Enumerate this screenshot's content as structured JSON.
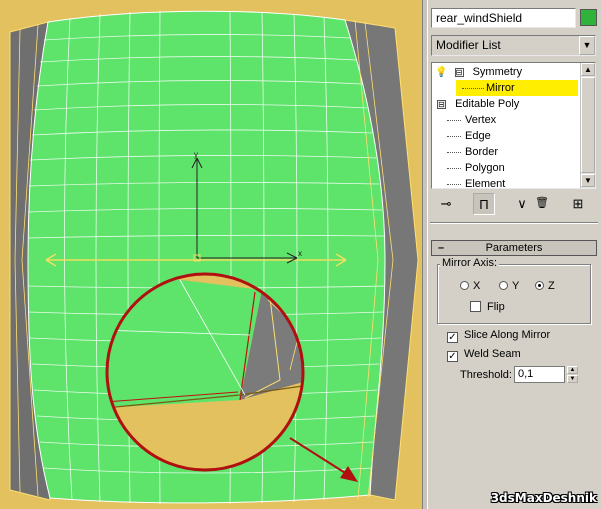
{
  "viewport": {
    "colors": {
      "background": "#e2c15e",
      "mesh": "#5ee36b",
      "mesh_dark": "#808080",
      "wire": "#ffffff",
      "axis": "#222222",
      "gizmo": "#f0e060",
      "callout": "#b01010"
    },
    "gizmo_labels": {
      "y": "y",
      "x": "x"
    }
  },
  "panel": {
    "object_name": "rear_windShield",
    "object_color": "#2fb33b",
    "modifier_list": {
      "label": "Modifier List"
    },
    "stack": [
      {
        "label": "Symmetry",
        "kind": "modifier",
        "expanded": "⊟",
        "icon": "lightbulb-icon"
      },
      {
        "label": "Mirror",
        "kind": "sub",
        "selected": true
      },
      {
        "label": "Editable Poly",
        "kind": "base",
        "expanded": "⊟"
      },
      {
        "label": "Vertex",
        "kind": "sub"
      },
      {
        "label": "Edge",
        "kind": "sub"
      },
      {
        "label": "Border",
        "kind": "sub"
      },
      {
        "label": "Polygon",
        "kind": "sub"
      },
      {
        "label": "Element",
        "kind": "sub"
      }
    ],
    "toolbar": [
      {
        "name": "pin-stack-icon",
        "glyph": "⊸"
      },
      {
        "name": "show-end-result-icon",
        "glyph": "Π"
      },
      {
        "name": "make-unique-icon",
        "glyph": "∨"
      },
      {
        "name": "remove-modifier-icon",
        "glyph": "🗑"
      },
      {
        "name": "configure-sets-icon",
        "glyph": "⊞"
      }
    ],
    "parameters": {
      "title": "Parameters",
      "collapse": "–",
      "mirror_axis": {
        "label": "Mirror Axis:",
        "options": [
          "X",
          "Y",
          "Z"
        ],
        "selected": "Z"
      },
      "flip": {
        "label": "Flip",
        "checked": false
      },
      "slice_along_mirror": {
        "label": "Slice Along Mirror",
        "checked": true,
        "mark": "✓"
      },
      "weld_seam": {
        "label": "Weld Seam",
        "checked": true,
        "mark": "✓"
      },
      "threshold": {
        "label": "Threshold:",
        "value": "0,1"
      }
    }
  },
  "watermark": "3dsMaxDeshnik"
}
